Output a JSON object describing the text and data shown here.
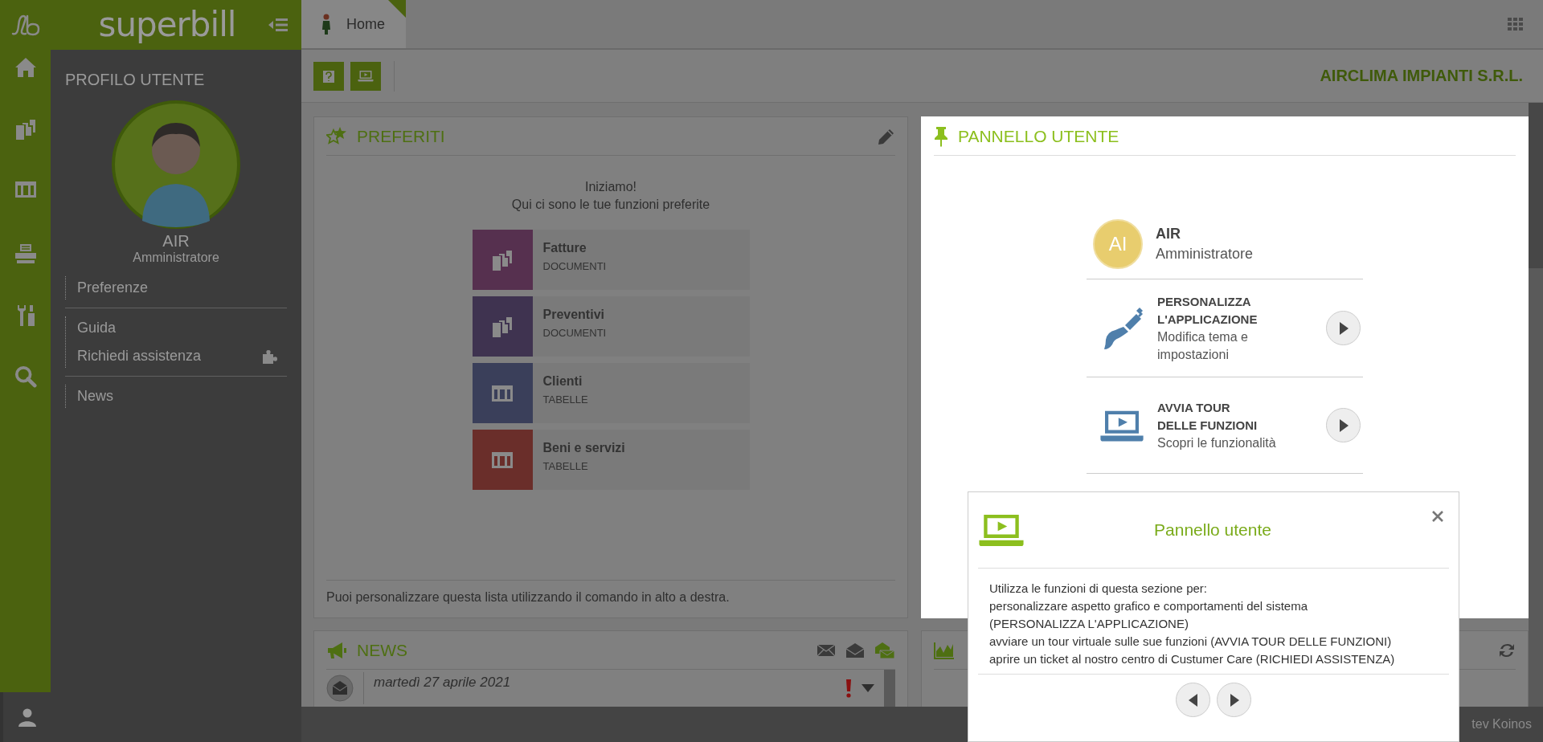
{
  "app": {
    "logo": "superbill"
  },
  "sidebar": {
    "title": "PROFILO UTENTE",
    "user_name": "AIR",
    "user_role": "Amministratore",
    "groups": [
      [
        {
          "label": "Preferenze"
        }
      ],
      [
        {
          "label": "Guida"
        },
        {
          "label": "Richiedi assistenza",
          "kind": "puzzle"
        }
      ],
      [
        {
          "label": "News"
        }
      ]
    ]
  },
  "tabs": [
    {
      "label": "Home",
      "selected": true
    }
  ],
  "company": "AIRCLIMA IMPIANTI S.R.L.",
  "favorites": {
    "title": "PREFERITI",
    "intro": [
      "Iniziamo!",
      "Qui ci sono le tue funzioni preferite"
    ],
    "items": [
      {
        "label": "Fatture",
        "category": "DOCUMENTI",
        "kind": "documents",
        "color": "#56304f"
      },
      {
        "label": "Preventivi",
        "category": "DOCUMENTI",
        "kind": "documents",
        "color": "#3f3350"
      },
      {
        "label": "Clienti",
        "category": "TABELLE",
        "kind": "table",
        "color": "#3a3f5a"
      },
      {
        "label": "Beni e servizi",
        "category": "TABELLE",
        "kind": "table",
        "color": "#6a2e2a"
      }
    ],
    "footer": "Puoi personalizzare questa lista utilizzando il comando in alto a destra."
  },
  "news": {
    "title": "NEWS",
    "items": [
      {
        "date": "martedì 27 aprile 2021",
        "important": true
      }
    ]
  },
  "user_panel": {
    "title": "PANNELLO UTENTE",
    "initials": "AI",
    "name": "AIR",
    "role": "Amministratore",
    "actions": [
      {
        "kind": "brush",
        "title_lines": [
          "PERSONALIZZA",
          "L'APPLICAZIONE"
        ],
        "description": "Modifica tema e impostazioni"
      },
      {
        "kind": "tour",
        "title_lines": [
          "AVVIA TOUR",
          "DELLE FUNZIONI"
        ],
        "description": "Scopri le funzionalità"
      }
    ]
  },
  "status_bar": {
    "text": "tev Koinos"
  },
  "popup": {
    "title": "Pannello utente",
    "body_lines": [
      "Utilizza le funzioni di questa sezione per:",
      "personalizzare aspetto grafico e comportamenti del sistema",
      "(PERSONALIZZA L'APPLICAZIONE)",
      "avviare un tour virtuale sulle sue funzioni (AVVIA TOUR DELLE FUNZIONI)",
      "aprire un ticket al nostro centro di Custumer Care (RICHIEDI ASSISTENZA)"
    ]
  }
}
